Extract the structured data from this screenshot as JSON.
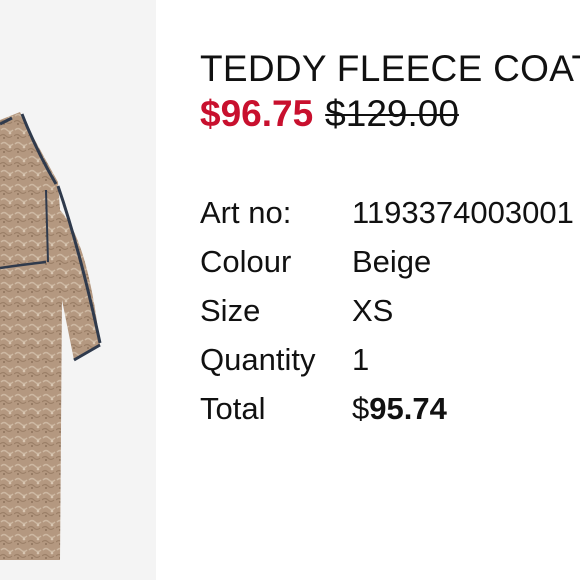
{
  "product": {
    "title": "TEDDY FLEECE COAT",
    "price_current": "$96.75",
    "price_original": "$129.00",
    "image_icon": "teddy-fleece-coat-photo"
  },
  "specs": [
    {
      "label": "Art no:",
      "value": "1193374003001"
    },
    {
      "label": "Colour",
      "value": "Beige"
    },
    {
      "label": "Size",
      "value": "XS"
    },
    {
      "label": "Quantity",
      "value": "1"
    }
  ],
  "total": {
    "label": "Total",
    "currency": "$",
    "amount": "95.74"
  },
  "colors": {
    "sale_red": "#c8102e",
    "text": "#111111",
    "fleece": "#b89d83",
    "image_bg": "#f4f4f4"
  }
}
